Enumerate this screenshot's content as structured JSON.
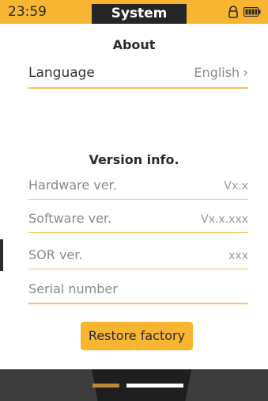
{
  "status_bar": {
    "time": "23:59",
    "title": "System",
    "icons": [
      "lock-icon",
      "battery-icon"
    ]
  },
  "about": {
    "heading": "About",
    "language_label": "Language",
    "language_value": "English"
  },
  "version": {
    "heading": "Version info.",
    "rows": [
      {
        "label": "Hardware ver.",
        "value": "Vx.x"
      },
      {
        "label": "Software ver.",
        "value": "Vx.x.xxx"
      },
      {
        "label": "SOR ver.",
        "value": "xxx"
      },
      {
        "label": "Serial number",
        "value": ""
      }
    ]
  },
  "actions": {
    "restore_label": "Restore factory"
  },
  "pager": {
    "pages": 2,
    "active": 1
  },
  "colors": {
    "accent": "#f7b531",
    "dark": "#262626"
  }
}
